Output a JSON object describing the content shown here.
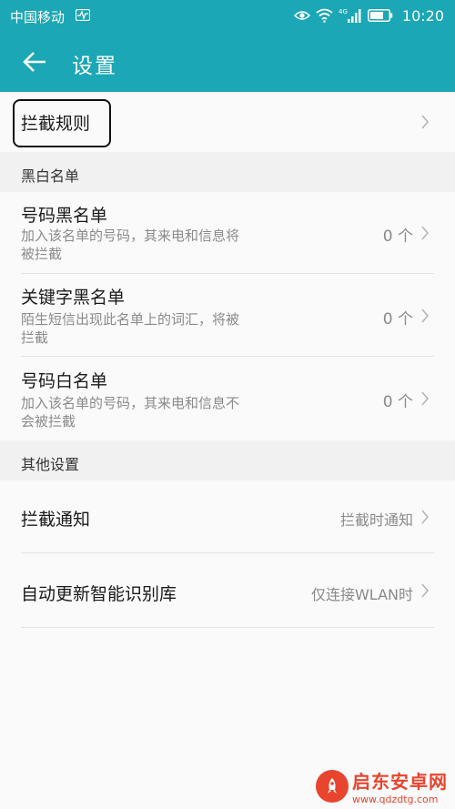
{
  "status_bar": {
    "carrier": "中国移动",
    "network": "4G",
    "time": "10:20",
    "icons": [
      "activity-icon",
      "eye-icon",
      "wifi-icon",
      "signal-icon",
      "battery-icon"
    ]
  },
  "app_bar": {
    "title": "设置",
    "back_icon": "arrow-left-icon"
  },
  "intercept_rules": {
    "label": "拦截规则"
  },
  "blacklist_section": {
    "header": "黑白名单",
    "items": [
      {
        "title": "号码黑名单",
        "subtitle_lines": [
          "加入该名单的号码，其来电和信息将",
          "被拦截"
        ],
        "count": "0 个"
      },
      {
        "title": "关键字黑名单",
        "subtitle_lines": [
          "陌生短信出现此名单上的词汇，将被",
          "拦截"
        ],
        "count": "0 个"
      },
      {
        "title": "号码白名单",
        "subtitle_lines": [
          "加入该名单的号码，其来电和信息不",
          "会被拦截"
        ],
        "count": "0 个"
      }
    ]
  },
  "other_section": {
    "header": "其他设置",
    "items": [
      {
        "title": "拦截通知",
        "value": "拦截时通知"
      },
      {
        "title": "自动更新智能识别库",
        "value": "仅连接WLAN时"
      }
    ]
  },
  "watermark": {
    "name": "启东安卓网",
    "url": "www.qdzdtg.com"
  },
  "colors": {
    "app_bar": "#1ba7b5",
    "background": "#fafafa",
    "section_background": "#f1f1f1",
    "secondary_text": "#8a8a8a",
    "watermark": "#e8442e"
  }
}
